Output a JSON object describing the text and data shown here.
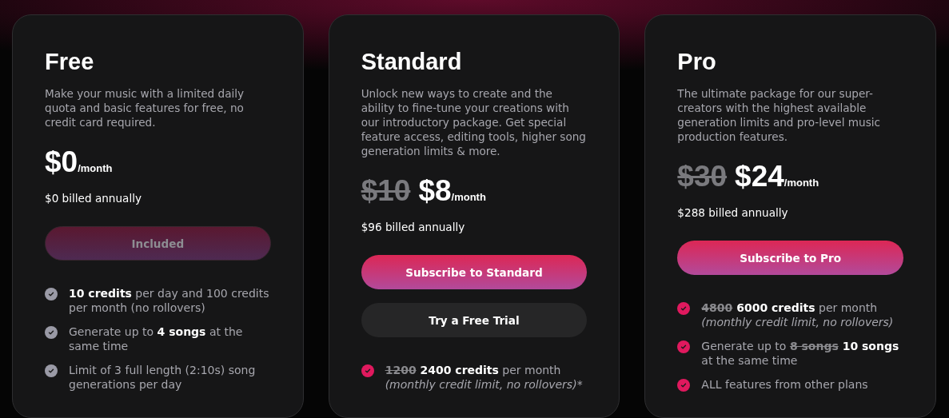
{
  "plans": [
    {
      "name": "Free",
      "description": "Make your music with a limited daily quota and basic features for free, no credit card required.",
      "price": "$0",
      "period": "/month",
      "billed": "$0 billed annually",
      "buttons": [
        {
          "label": "Included",
          "kind": "primary",
          "disabled": true
        }
      ],
      "features": [
        {
          "color": "#9a9aa6",
          "parts": [
            {
              "kind": "bold",
              "text": "10 credits"
            },
            {
              "kind": "plain",
              "text": " per day and 100 credits per month (no rollovers)"
            }
          ]
        },
        {
          "color": "#9a9aa6",
          "parts": [
            {
              "kind": "plain",
              "text": "Generate up to "
            },
            {
              "kind": "bold",
              "text": "4 songs"
            },
            {
              "kind": "plain",
              "text": " at the same time"
            }
          ]
        },
        {
          "color": "#9a9aa6",
          "parts": [
            {
              "kind": "plain",
              "text": "Limit of 3 full length (2:10s) song generations per day"
            }
          ]
        }
      ]
    },
    {
      "name": "Standard",
      "description": "Unlock new ways to create and the ability to fine-tune your creations with our introductory package. Get special feature access, editing tools, higher song generation limits & more.",
      "old_price": "$10",
      "price": "$8",
      "period": "/month",
      "billed": "$96 billed annually",
      "buttons": [
        {
          "label": "Subscribe to Standard",
          "kind": "primary",
          "disabled": false
        },
        {
          "label": "Try a Free Trial",
          "kind": "secondary",
          "disabled": false
        }
      ],
      "features": [
        {
          "color": "#e0195e",
          "parts": [
            {
              "kind": "struck",
              "text": "1200"
            },
            {
              "kind": "bold",
              "text": " 2400 credits"
            },
            {
              "kind": "plain",
              "text": " per month "
            },
            {
              "kind": "italic",
              "text": "(monthly credit limit, no rollovers)*"
            }
          ]
        }
      ]
    },
    {
      "name": "Pro",
      "description": "The ultimate package for our super-creators with the highest available generation limits and pro-level music production features.",
      "old_price": "$30",
      "price": "$24",
      "period": "/month",
      "billed": "$288 billed annually",
      "buttons": [
        {
          "label": "Subscribe to Pro",
          "kind": "primary",
          "disabled": false
        }
      ],
      "features": [
        {
          "color": "#e0195e",
          "parts": [
            {
              "kind": "struck",
              "text": "4800"
            },
            {
              "kind": "bold",
              "text": " 6000 credits"
            },
            {
              "kind": "plain",
              "text": " per month "
            },
            {
              "kind": "italic",
              "text": "(monthly credit limit, no rollovers)"
            }
          ]
        },
        {
          "color": "#e0195e",
          "parts": [
            {
              "kind": "plain",
              "text": "Generate up to "
            },
            {
              "kind": "struck",
              "text": "8 songs"
            },
            {
              "kind": "bold",
              "text": " 10 songs"
            },
            {
              "kind": "plain",
              "text": " at the same time"
            }
          ]
        },
        {
          "color": "#e0195e",
          "parts": [
            {
              "kind": "plain",
              "text": "ALL features from other plans"
            }
          ]
        }
      ]
    }
  ]
}
